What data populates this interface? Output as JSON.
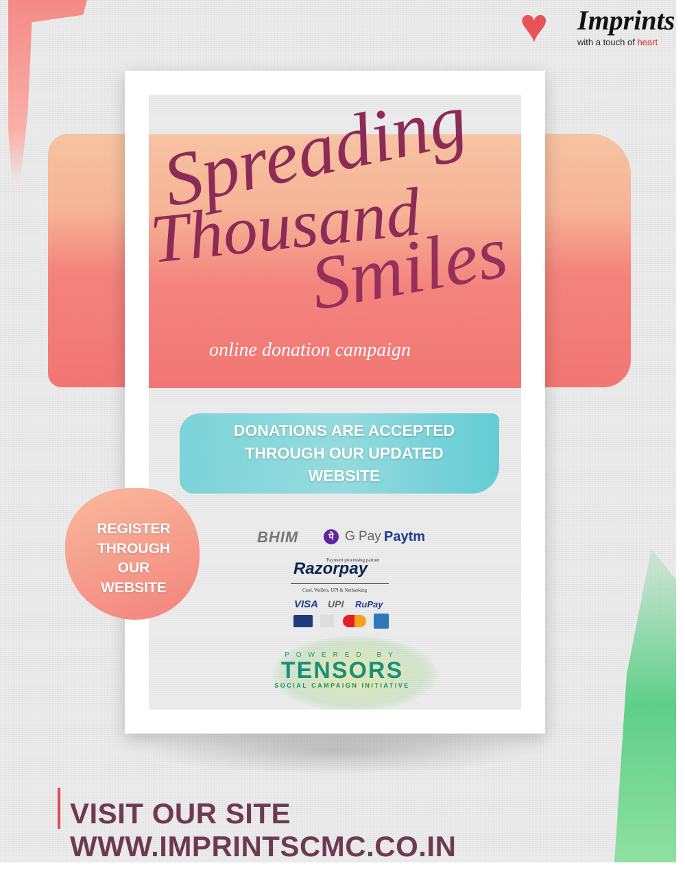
{
  "brand": {
    "name": "Imprints",
    "tagline_prefix": "with a touch of ",
    "tagline_highlight": "heart"
  },
  "poster": {
    "title_line1": "Spreading",
    "title_line2": "Thousand",
    "title_line3": "Smiles",
    "subtitle": "online donation campaign",
    "donation_notice": [
      "DONATIONS ARE ACCEPTED",
      "THROUGH OUR UPDATED",
      "WEBSITE"
    ],
    "payments": {
      "bhim": "BHIM",
      "phonepe": "पे",
      "gpay": "G Pay",
      "paytm": "Paytm",
      "partner_label": "Payment processing partner",
      "razorpay": "Razorpay",
      "methods": "Card, Wallets, UPI & Netbanking",
      "visa": "VISA",
      "upi": "UPI",
      "rupay": "RuPay"
    },
    "powered": {
      "label": "POWERED BY",
      "name": "TENSORS",
      "tagline": "SOCIAL CAMPAIGN INITIATIVE"
    }
  },
  "register": [
    "REGISTER",
    "THROUGH",
    "OUR",
    "WEBSITE"
  ],
  "footer": "VISIT OUR SITE WWW.IMPRINTSCMC.CO.IN",
  "colors": {
    "title": "#8d2b57",
    "accent": "#d94a57",
    "teal": "#6fd1d6",
    "footer": "#6e3a4f"
  }
}
